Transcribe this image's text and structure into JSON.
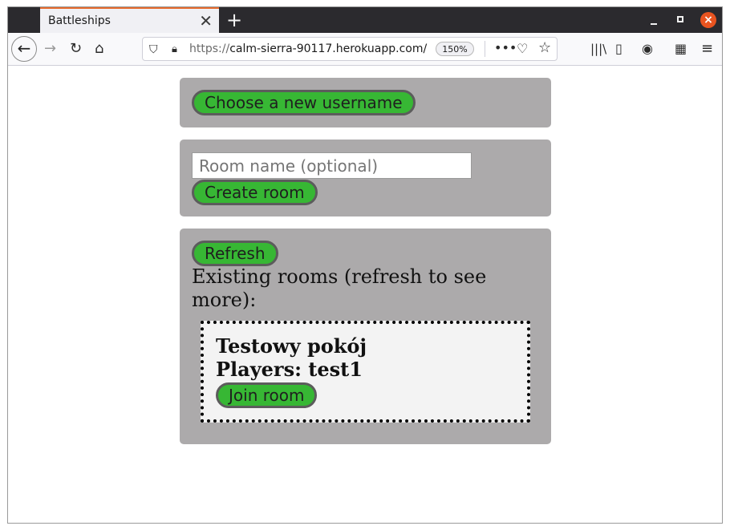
{
  "browser": {
    "tab_title": "Battleships",
    "tab_close": "✕",
    "new_tab": "+",
    "url_scheme": "https://",
    "url_host": "calm-sierra-90117.herokuapp.com/",
    "zoom": "150%",
    "icons": [
      "back-arrow-icon",
      "forward-arrow-icon",
      "reload-icon",
      "home-icon",
      "shield-icon",
      "lock-icon",
      "more-icon",
      "pocket-icon",
      "star-icon",
      "library-icon",
      "sidebar-icon",
      "account-icon",
      "extensions-icon",
      "menu-icon"
    ]
  },
  "username_card": {
    "button_label": "Choose a new username"
  },
  "create_card": {
    "placeholder": "Room name (optional)",
    "button_label": "Create room"
  },
  "rooms_card": {
    "refresh_label": "Refresh",
    "existing_text": "Existing rooms (refresh to see more):",
    "rooms": [
      {
        "name": "Testowy pokój",
        "players": "Players: test1",
        "join_label": "Join room"
      }
    ]
  },
  "colors": {
    "card_bg": "#acaaab",
    "button_green": "#37b734",
    "tab_accent": "#e66a2c",
    "close_orange": "#e95420"
  }
}
